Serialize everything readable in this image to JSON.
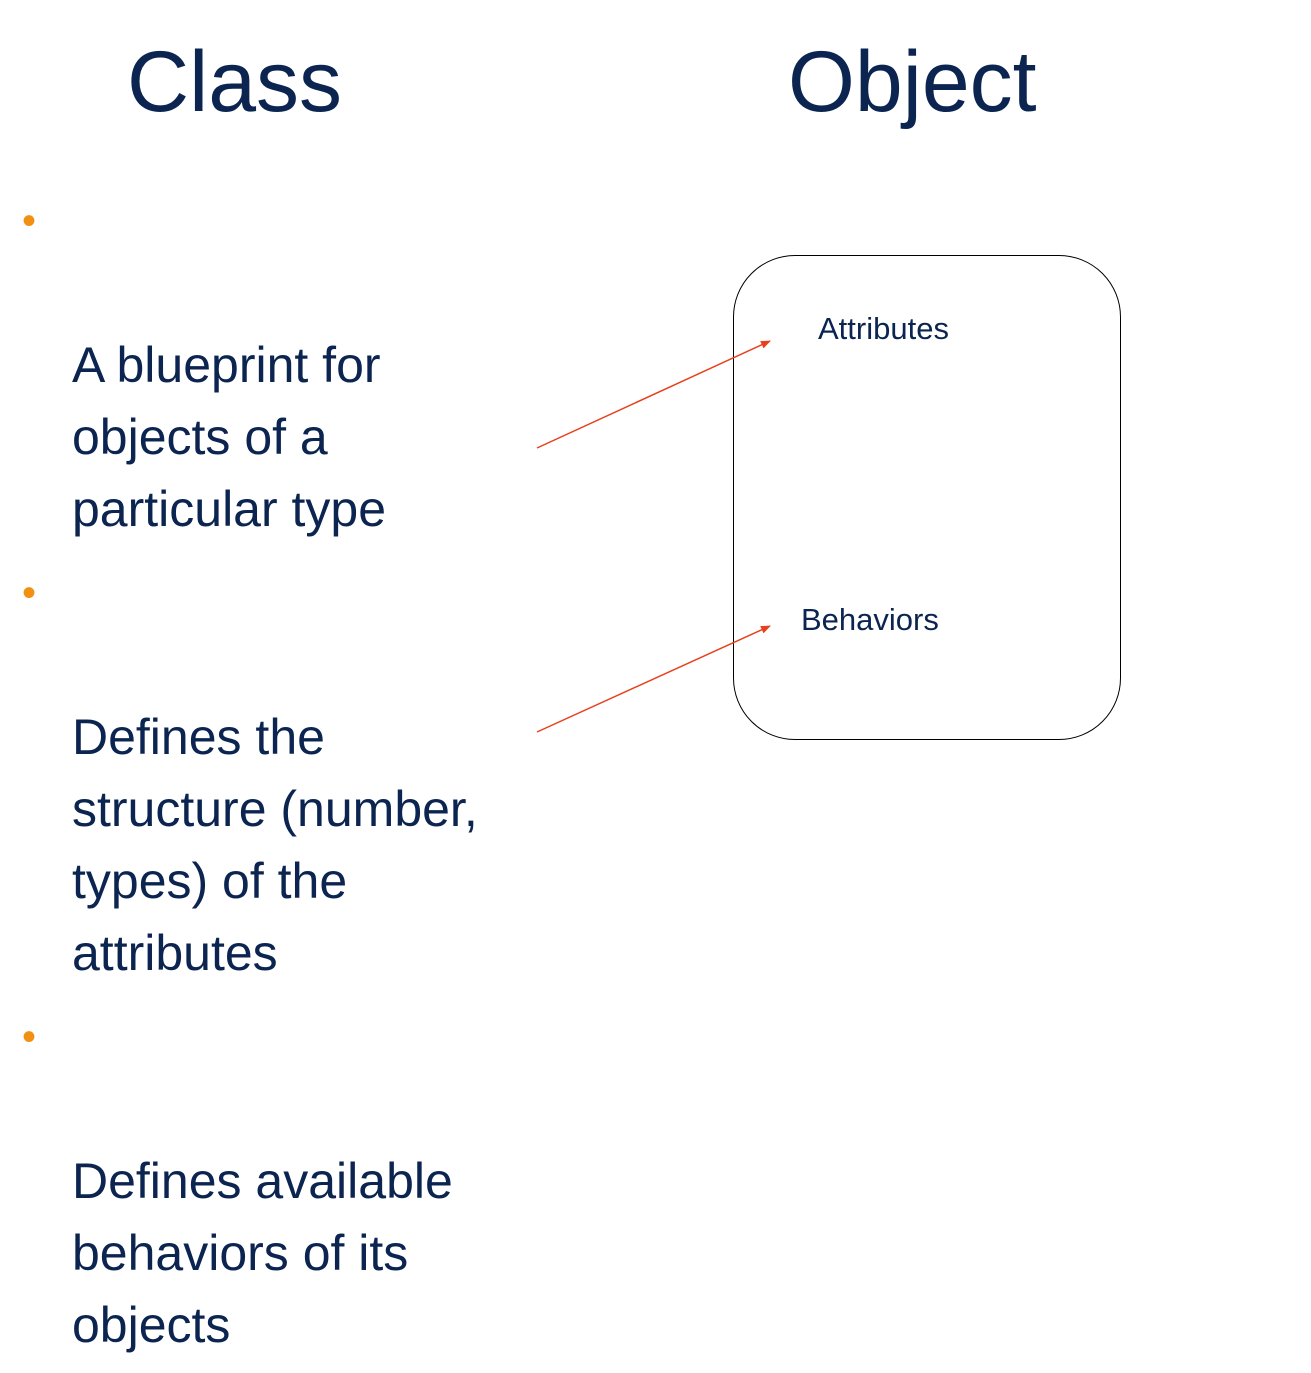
{
  "headings": {
    "class": "Class",
    "object": "Object"
  },
  "bullets": [
    "A blueprint for\nobjects of a\nparticular type",
    "Defines the\nstructure (number,\ntypes) of the\nattributes",
    "Defines available\nbehaviors of its\nobjects"
  ],
  "bullet_glyph": "•",
  "object_box": {
    "attributes_label": "Attributes",
    "behaviors_label": "Behaviors"
  },
  "colors": {
    "text": "#0b2450",
    "bullet": "#f29012",
    "arrow": "#e8401c",
    "box_border": "#000000"
  }
}
